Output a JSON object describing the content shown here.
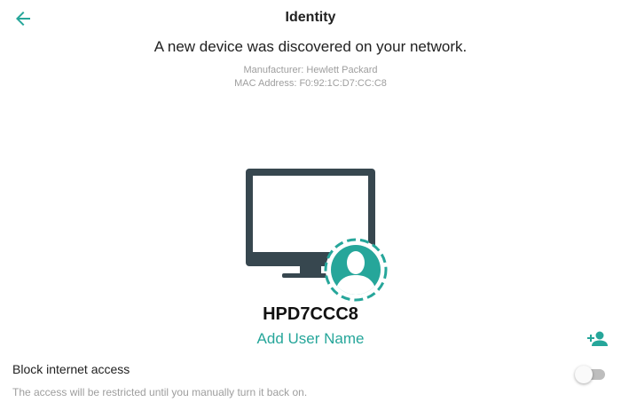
{
  "header": {
    "title": "Identity",
    "back_icon": "arrow-left-icon"
  },
  "discovery": {
    "headline": "A new device was discovered on your network.",
    "manufacturer": "Manufacturer: Hewlett Packard",
    "mac_address": "MAC Address: F0:92:1C:D7:CC:C8"
  },
  "device": {
    "illustration_icon": "monitor-with-user-icon",
    "name": "HPD7CCC8",
    "add_user_name_label": "Add User Name",
    "add_person_icon": "person-add-icon"
  },
  "settings": {
    "block_internet_label": "Block internet access",
    "block_internet_description": "The access will be restricted until you manually turn it back on.",
    "block_internet_enabled": false
  },
  "colors": {
    "accent": "#26a69a",
    "monitor": "#37474f",
    "muted_text": "#9e9e9e"
  }
}
